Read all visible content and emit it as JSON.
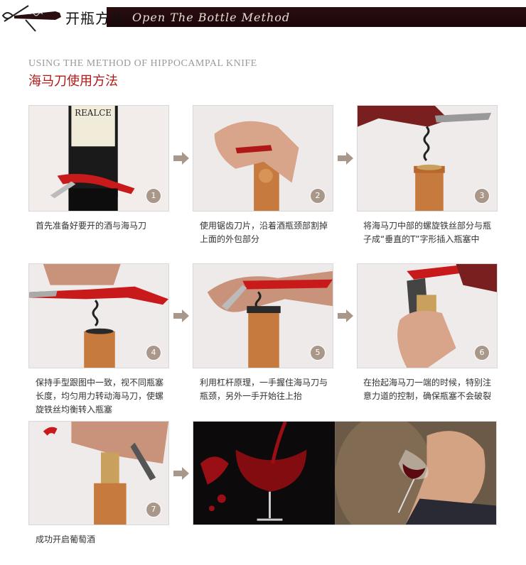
{
  "header": {
    "title": "开瓶方法",
    "script_title": "Open The Bottle Method"
  },
  "section": {
    "title_en": "USING THE METHOD OF HIPPOCAMPAL KNIFE",
    "title_cn": "海马刀使用方法"
  },
  "bottle_label": "REALCE",
  "steps": [
    {
      "num": "1",
      "text": "首先准备好要开的酒与海马刀"
    },
    {
      "num": "2",
      "text": "使用锯齿刀片，沿着酒瓶颈部割掉上面的外包部分"
    },
    {
      "num": "3",
      "text": "将海马刀中部的螺旋铁丝部分与瓶子成“垂直的T”字形插入瓶塞中"
    },
    {
      "num": "4",
      "text": "保持手型跟图中一致，视不同瓶塞长度，均匀用力转动海马刀，使螺旋铁丝均衡转入瓶塞"
    },
    {
      "num": "5",
      "text": "利用杠杆原理，一手握住海马刀与瓶颈，另外一手开始往上抬"
    },
    {
      "num": "6",
      "text": "在抬起海马刀一端的时候，特别注意力道的控制，确保瓶塞不会破裂"
    },
    {
      "num": "7",
      "text": "成功开启葡萄酒"
    }
  ],
  "colors": {
    "header_bar": "#1c0608",
    "accent_red": "#b01818",
    "arrow": "#a9988a",
    "badge": "#a9988a"
  }
}
